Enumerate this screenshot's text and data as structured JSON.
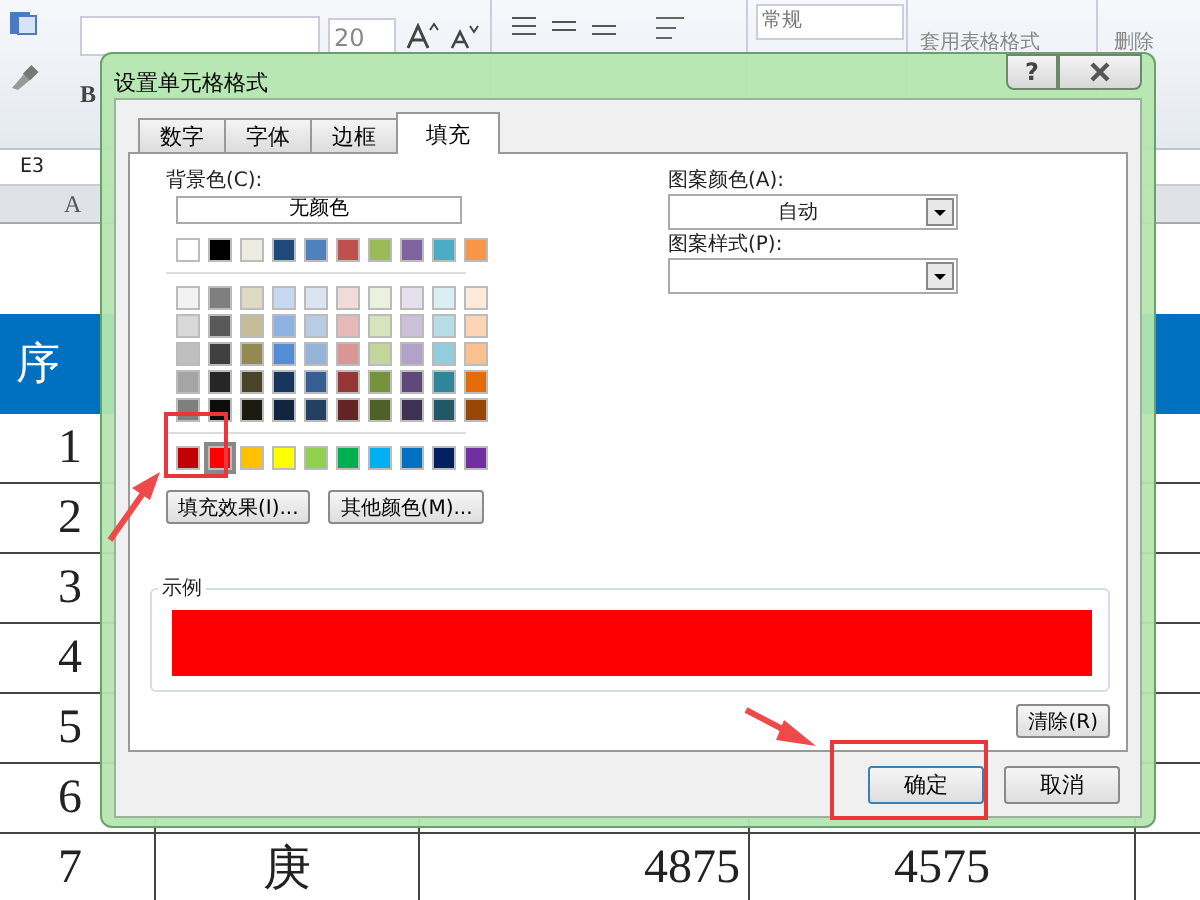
{
  "ribbon": {
    "font_size": "20",
    "bold_button": "B",
    "number_format": "常规",
    "format_as_table": "套用表格格式",
    "delete": "删除"
  },
  "name_box": "E3",
  "column_header": "A",
  "sheet": {
    "header": "序",
    "rows": [
      {
        "number": "1"
      },
      {
        "number": "2"
      },
      {
        "number": "3"
      },
      {
        "number": "4"
      },
      {
        "number": "5"
      },
      {
        "number": "6"
      },
      {
        "number": "7",
        "name": "庚",
        "value_1": "4875",
        "value_2": "4575"
      }
    ]
  },
  "dialog": {
    "title": "设置单元格格式",
    "help_button": "?",
    "tabs": [
      {
        "label": "数字",
        "selected": false
      },
      {
        "label": "字体",
        "selected": false
      },
      {
        "label": "边框",
        "selected": false
      },
      {
        "label": "填充",
        "selected": true
      }
    ],
    "background_color_label": "背景色(C):",
    "no_color_button": "无颜色",
    "theme_colors": [
      {
        "swatches": [
          {
            "color": "#ffffff",
            "selected": false
          },
          {
            "color": "#000000",
            "selected": false
          },
          {
            "color": "#eeece1",
            "selected": false
          },
          {
            "color": "#1f497d",
            "selected": false
          },
          {
            "color": "#4f81bd",
            "selected": false
          },
          {
            "color": "#c0504d",
            "selected": false
          },
          {
            "color": "#9bbb59",
            "selected": false
          },
          {
            "color": "#8064a2",
            "selected": false
          },
          {
            "color": "#4bacc6",
            "selected": false
          },
          {
            "color": "#f79646",
            "selected": false
          }
        ]
      }
    ],
    "tint_rows": [
      {
        "swatches": [
          {
            "color": "#f2f2f2",
            "selected": false
          },
          {
            "color": "#7f7f7f",
            "selected": false
          },
          {
            "color": "#ddd9c3",
            "selected": false
          },
          {
            "color": "#c6d9f0",
            "selected": false
          },
          {
            "color": "#dbe5f1",
            "selected": false
          },
          {
            "color": "#f2dcdb",
            "selected": false
          },
          {
            "color": "#ebf1dd",
            "selected": false
          },
          {
            "color": "#e5e0ec",
            "selected": false
          },
          {
            "color": "#dbeef3",
            "selected": false
          },
          {
            "color": "#fdeada",
            "selected": false
          }
        ]
      },
      {
        "swatches": [
          {
            "color": "#d8d8d8",
            "selected": false
          },
          {
            "color": "#595959",
            "selected": false
          },
          {
            "color": "#c4bd97",
            "selected": false
          },
          {
            "color": "#8db3e2",
            "selected": false
          },
          {
            "color": "#b8cce4",
            "selected": false
          },
          {
            "color": "#e5b9b7",
            "selected": false
          },
          {
            "color": "#d7e3bc",
            "selected": false
          },
          {
            "color": "#ccc1d9",
            "selected": false
          },
          {
            "color": "#b7dde8",
            "selected": false
          },
          {
            "color": "#fbd5b5",
            "selected": false
          }
        ]
      },
      {
        "swatches": [
          {
            "color": "#bfbfbf",
            "selected": false
          },
          {
            "color": "#3f3f3f",
            "selected": false
          },
          {
            "color": "#938953",
            "selected": false
          },
          {
            "color": "#548dd4",
            "selected": false
          },
          {
            "color": "#95b3d7",
            "selected": false
          },
          {
            "color": "#d99694",
            "selected": false
          },
          {
            "color": "#c3d69b",
            "selected": false
          },
          {
            "color": "#b2a2c7",
            "selected": false
          },
          {
            "color": "#92cddc",
            "selected": false
          },
          {
            "color": "#fac08f",
            "selected": false
          }
        ]
      },
      {
        "swatches": [
          {
            "color": "#a5a5a5",
            "selected": false
          },
          {
            "color": "#262626",
            "selected": false
          },
          {
            "color": "#494429",
            "selected": false
          },
          {
            "color": "#17365d",
            "selected": false
          },
          {
            "color": "#366092",
            "selected": false
          },
          {
            "color": "#953734",
            "selected": false
          },
          {
            "color": "#76923c",
            "selected": false
          },
          {
            "color": "#5f497a",
            "selected": false
          },
          {
            "color": "#31859b",
            "selected": false
          },
          {
            "color": "#e36c09",
            "selected": false
          }
        ]
      },
      {
        "swatches": [
          {
            "color": "#7f7f7f",
            "selected": false
          },
          {
            "color": "#0c0c0c",
            "selected": false
          },
          {
            "color": "#1d1b10",
            "selected": false
          },
          {
            "color": "#0f243e",
            "selected": false
          },
          {
            "color": "#244061",
            "selected": false
          },
          {
            "color": "#632423",
            "selected": false
          },
          {
            "color": "#4f6128",
            "selected": false
          },
          {
            "color": "#3f3151",
            "selected": false
          },
          {
            "color": "#205867",
            "selected": false
          },
          {
            "color": "#974806",
            "selected": false
          }
        ]
      }
    ],
    "standard_colors": [
      {
        "swatches": [
          {
            "color": "#c00000",
            "selected": false
          },
          {
            "color": "#ff0000",
            "selected": true
          },
          {
            "color": "#ffc000",
            "selected": false
          },
          {
            "color": "#ffff00",
            "selected": false
          },
          {
            "color": "#92d050",
            "selected": false
          },
          {
            "color": "#00b050",
            "selected": false
          },
          {
            "color": "#00b0f0",
            "selected": false
          },
          {
            "color": "#0070c0",
            "selected": false
          },
          {
            "color": "#002060",
            "selected": false
          },
          {
            "color": "#7030a0",
            "selected": false
          }
        ]
      }
    ],
    "fill_effects_button": "填充效果(I)...",
    "more_colors_button": "其他颜色(M)...",
    "pattern_color_label": "图案颜色(A):",
    "pattern_color_value": "自动",
    "pattern_style_label": "图案样式(P):",
    "sample_label": "示例",
    "clear_button": "清除(R)",
    "ok_button": "确定",
    "cancel_button": "取消"
  }
}
